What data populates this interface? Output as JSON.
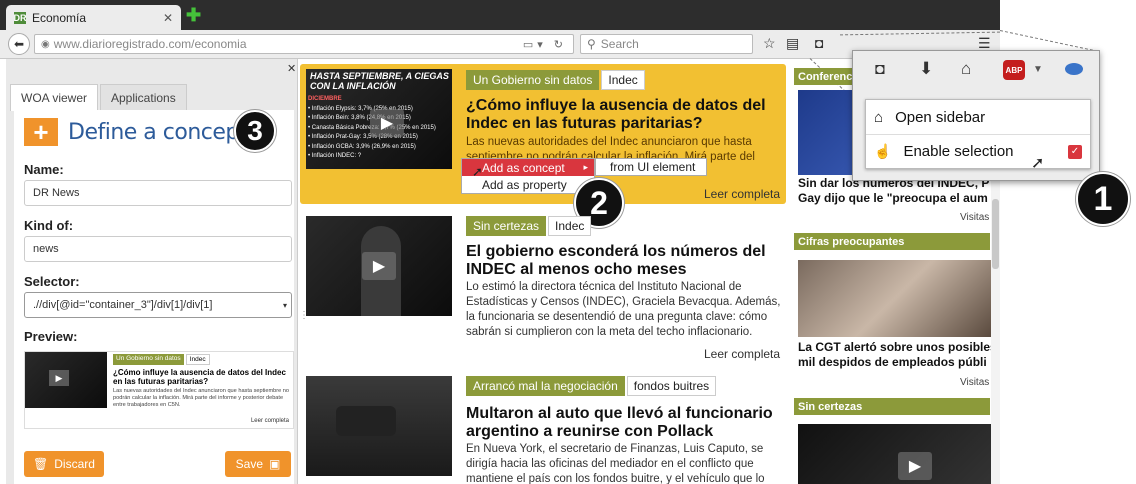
{
  "browser": {
    "tab_title": "Economía",
    "tab_favicon": "DR",
    "url_domain": "www.diarioregistrado.com",
    "url_path": "/economia",
    "search_placeholder": "Search"
  },
  "woa_panel": {
    "tabs": [
      "WOA viewer",
      "Applications"
    ],
    "title": "Define a concept",
    "name_label": "Name:",
    "name_value": "DR News",
    "kind_label": "Kind of:",
    "kind_value": "news",
    "selector_label": "Selector:",
    "selector_value": ".//div[@id=\"container_3\"]/div[1]/div[1]",
    "preview_label": "Preview:",
    "preview": {
      "tag1": "Un Gobierno sin datos",
      "tag2": "Indec",
      "headline": "¿Cómo influye la ausencia de datos del Indec en las futuras paritarias?",
      "summary": "Las nuevas autoridades del Indec anunciaron que hasta septiembre no podrán calcular la inflación. Mirá parte del informe y posterior debate entre trabajadores en C5N.",
      "more": "Leer completa"
    },
    "discard_label": "Discard",
    "save_label": "Save"
  },
  "articles": [
    {
      "tag1": "Un Gobierno sin datos",
      "tag2": "Indec",
      "headline": "¿Cómo influye la ausencia de datos del Indec en las futuras paritarias?",
      "summary": "Las nuevas autoridades del Indec anunciaron que hasta septiembre no podrán calcular la inflación. Mirá parte del informe y posterior",
      "more": "Leer completa",
      "thumb_title": "HASTA SEPTIEMBRE, A CIEGAS CON LA INFLACIÓN",
      "thumb_lines": [
        "DICIEMBRE",
        "• Inflación Elypsis: 3,7% (25% en 2015)",
        "• Inflación Bein: 3,8% (24,8% en 2015)",
        "• Canasta Básica Pobreza: 4,7% (25% en 2015)",
        "• Inflación Prat-Gay: 3,5% (28% en 2015)",
        "• Inflación GCBA: 3,9% (26,9% en 2015)",
        "• Inflación INDEC: ?"
      ]
    },
    {
      "tag1": "Sin certezas",
      "tag2": "Indec",
      "headline": "El gobierno esconderá los números del INDEC al menos ocho meses",
      "summary": "Lo estimó la directora técnica del Instituto Nacional de Estadísticas y Censos (INDEC), Graciela Bevacqua. Además, la funcionaria se desentendió de una pregunta clave: cómo sabrán si cumplieron con la meta del techo inflacionario.",
      "more": "Leer completa"
    },
    {
      "tag1": "Arrancó mal la negociación",
      "tag2": "fondos buitres",
      "headline": "Multaron al auto que llevó al funcionario argentino a reunirse con Pollack",
      "summary": "En Nueva York, el secretario de Finanzas, Luis Caputo, se dirigía hacia las oficinas del mediador en el conflicto que mantiene el país con los fondos buitre, y el vehículo que lo transportó quedó mal"
    }
  ],
  "right_column": {
    "sections": [
      {
        "header": "Conferencia",
        "text": "Sin dar los números del INDEC, P",
        "text2": "Gay dijo que le \"preocupa el aum",
        "visits": "Visitas"
      },
      {
        "header": "Cifras preocupantes",
        "text": "La CGT alertó sobre unos posibles",
        "text2": "mil despidos de empleados públi",
        "visits": "Visitas"
      },
      {
        "header": "Sin certezas"
      }
    ]
  },
  "context_menu": {
    "items": [
      "Add as concept",
      "Add as property"
    ],
    "submenu": "from UI element"
  },
  "extension_popup": {
    "items": [
      "Open sidebar",
      "Enable selection"
    ],
    "abp_label": "ABP"
  },
  "callouts": [
    "1",
    "2",
    "3"
  ],
  "colors": {
    "accent_orange": "#f0932b",
    "tag_green": "#8c9a3a",
    "highlight_yellow": "#f2c032",
    "context_red": "#d9363e",
    "title_blue": "#2d5b9a"
  }
}
